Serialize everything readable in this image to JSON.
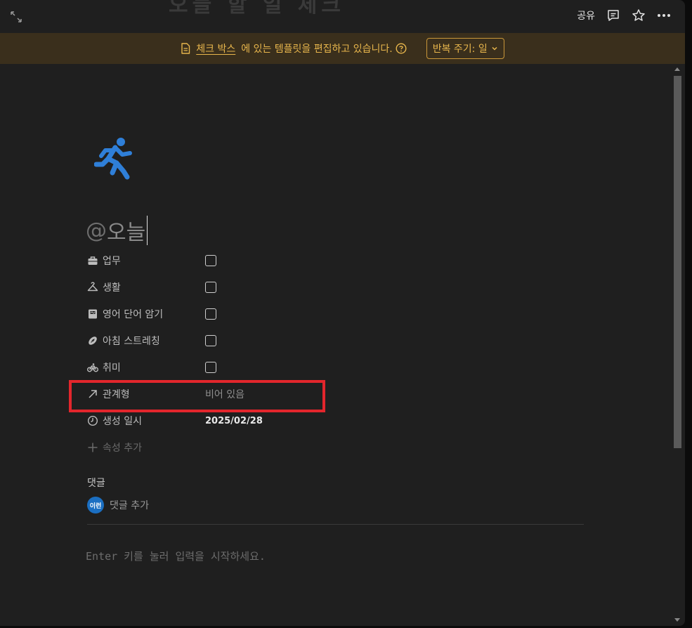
{
  "ghost_title": "오늘 할 일 체크",
  "topbar": {
    "share_label": "공유",
    "icons": [
      "expand-icon",
      "comment-icon",
      "star-icon",
      "more-icon"
    ]
  },
  "banner": {
    "link_text": "체크 박스",
    "message": "에 있는 템플릿을 편집하고 있습니다.",
    "repeat_label": "반복 주기: 일"
  },
  "page": {
    "icon": "running-person-icon",
    "title_prefix": "@",
    "title": "오늘"
  },
  "properties": [
    {
      "name": "업무",
      "icon": "briefcase-icon",
      "type": "checkbox",
      "checked": false
    },
    {
      "name": "생활",
      "icon": "hanger-icon",
      "type": "checkbox",
      "checked": false
    },
    {
      "name": "영어 단어 암기",
      "icon": "book-icon",
      "type": "checkbox",
      "checked": false
    },
    {
      "name": "아침 스트레칭",
      "icon": "football-icon",
      "type": "checkbox",
      "checked": false
    },
    {
      "name": "취미",
      "icon": "bicycle-icon",
      "type": "checkbox",
      "checked": false
    },
    {
      "name": "관계형",
      "icon": "arrow-up-right-icon",
      "type": "relation",
      "value": "비어 있음"
    },
    {
      "name": "생성 일시",
      "icon": "clock-icon",
      "type": "created_time",
      "value": "2025/02/28"
    }
  ],
  "add_property_label": "속성 추가",
  "comments": {
    "label": "댓글",
    "avatar_text": "이런",
    "add_label": "댓글 추가"
  },
  "body_placeholder": "Enter 키를 눌러 입력을 시작하세요.",
  "colors": {
    "banner_bg": "#3a2f1c",
    "banner_text": "#e8b64c",
    "highlight": "#e3262c",
    "icon_blue": "#2f7fd8"
  }
}
